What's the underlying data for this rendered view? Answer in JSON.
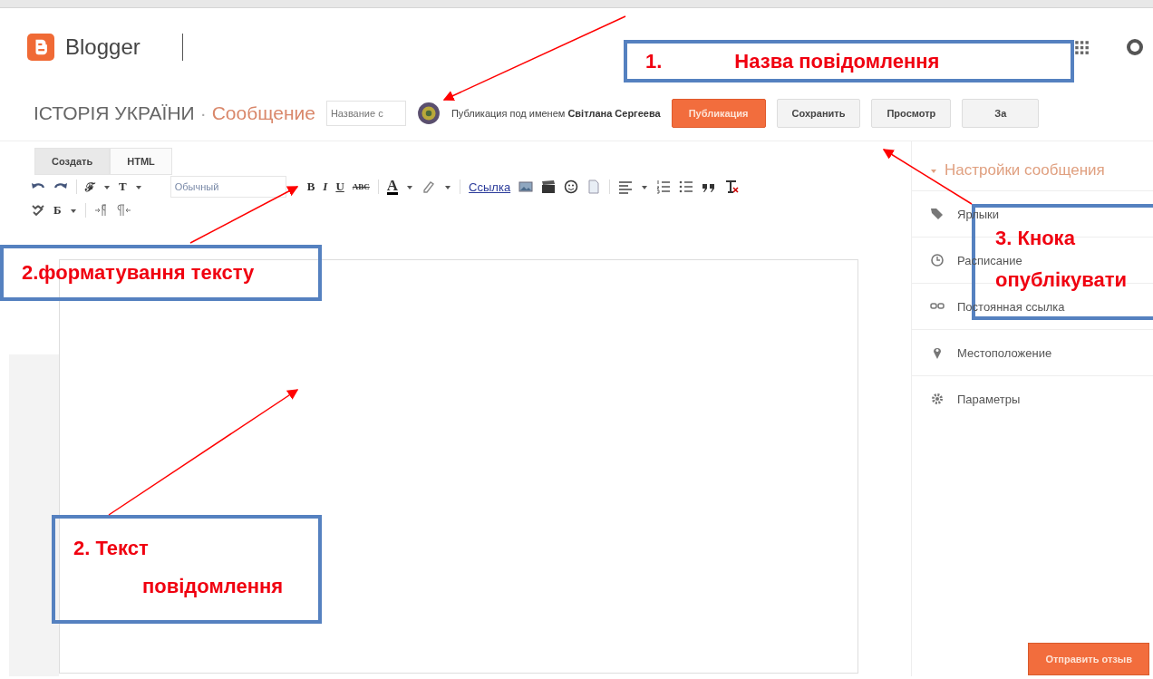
{
  "header": {
    "logo_text": "Blogger"
  },
  "post_bar": {
    "blog_title": "ІСТОРІЯ УКРАЇНИ",
    "separator": "·",
    "page": "Сообщение",
    "title_field": {
      "placeholder": "Название с"
    },
    "author_prefix": "Публикация под именем",
    "author_name": "Світлана Сергеева",
    "buttons": [
      {
        "label": "Публикация",
        "kind": "primary"
      },
      {
        "label": "Сохранить",
        "kind": "normal"
      },
      {
        "label": "Просмотр",
        "kind": "normal"
      },
      {
        "label": "За",
        "kind": "normal"
      }
    ]
  },
  "editor_tabs": [
    {
      "label": "Создать",
      "selected": true
    },
    {
      "label": "HTML",
      "selected": false
    }
  ],
  "toolbar": {
    "font": "ℱ",
    "size": "T",
    "style_select": "Обычный",
    "bold": "B",
    "italic": "I",
    "underline": "U",
    "strike": "ABC",
    "text_color": "A",
    "link": "Ссылка",
    "language": "Б"
  },
  "settings": {
    "title": "Настройки сообщения",
    "items": [
      {
        "label": "Ярлыки",
        "kind": "labels"
      },
      {
        "label": "Расписание",
        "kind": "schedule"
      },
      {
        "label": "Постоянная ссылка",
        "kind": "permalink"
      },
      {
        "label": "Местоположение",
        "kind": "location"
      },
      {
        "label": "Параметры",
        "kind": "options"
      }
    ]
  },
  "feedback_button": "Отправить отзыв",
  "callouts": [
    {
      "kind": "row",
      "texts": [
        "1.",
        "Назва повідомлення"
      ]
    },
    {
      "kind": "row",
      "texts": [
        "2.форматування тексту"
      ]
    },
    {
      "kind": "stack",
      "texts": [
        "3. Кнока",
        "опублікувати"
      ]
    },
    {
      "kind": "stair",
      "texts": [
        "2. Текст",
        "повідомлення"
      ]
    }
  ]
}
